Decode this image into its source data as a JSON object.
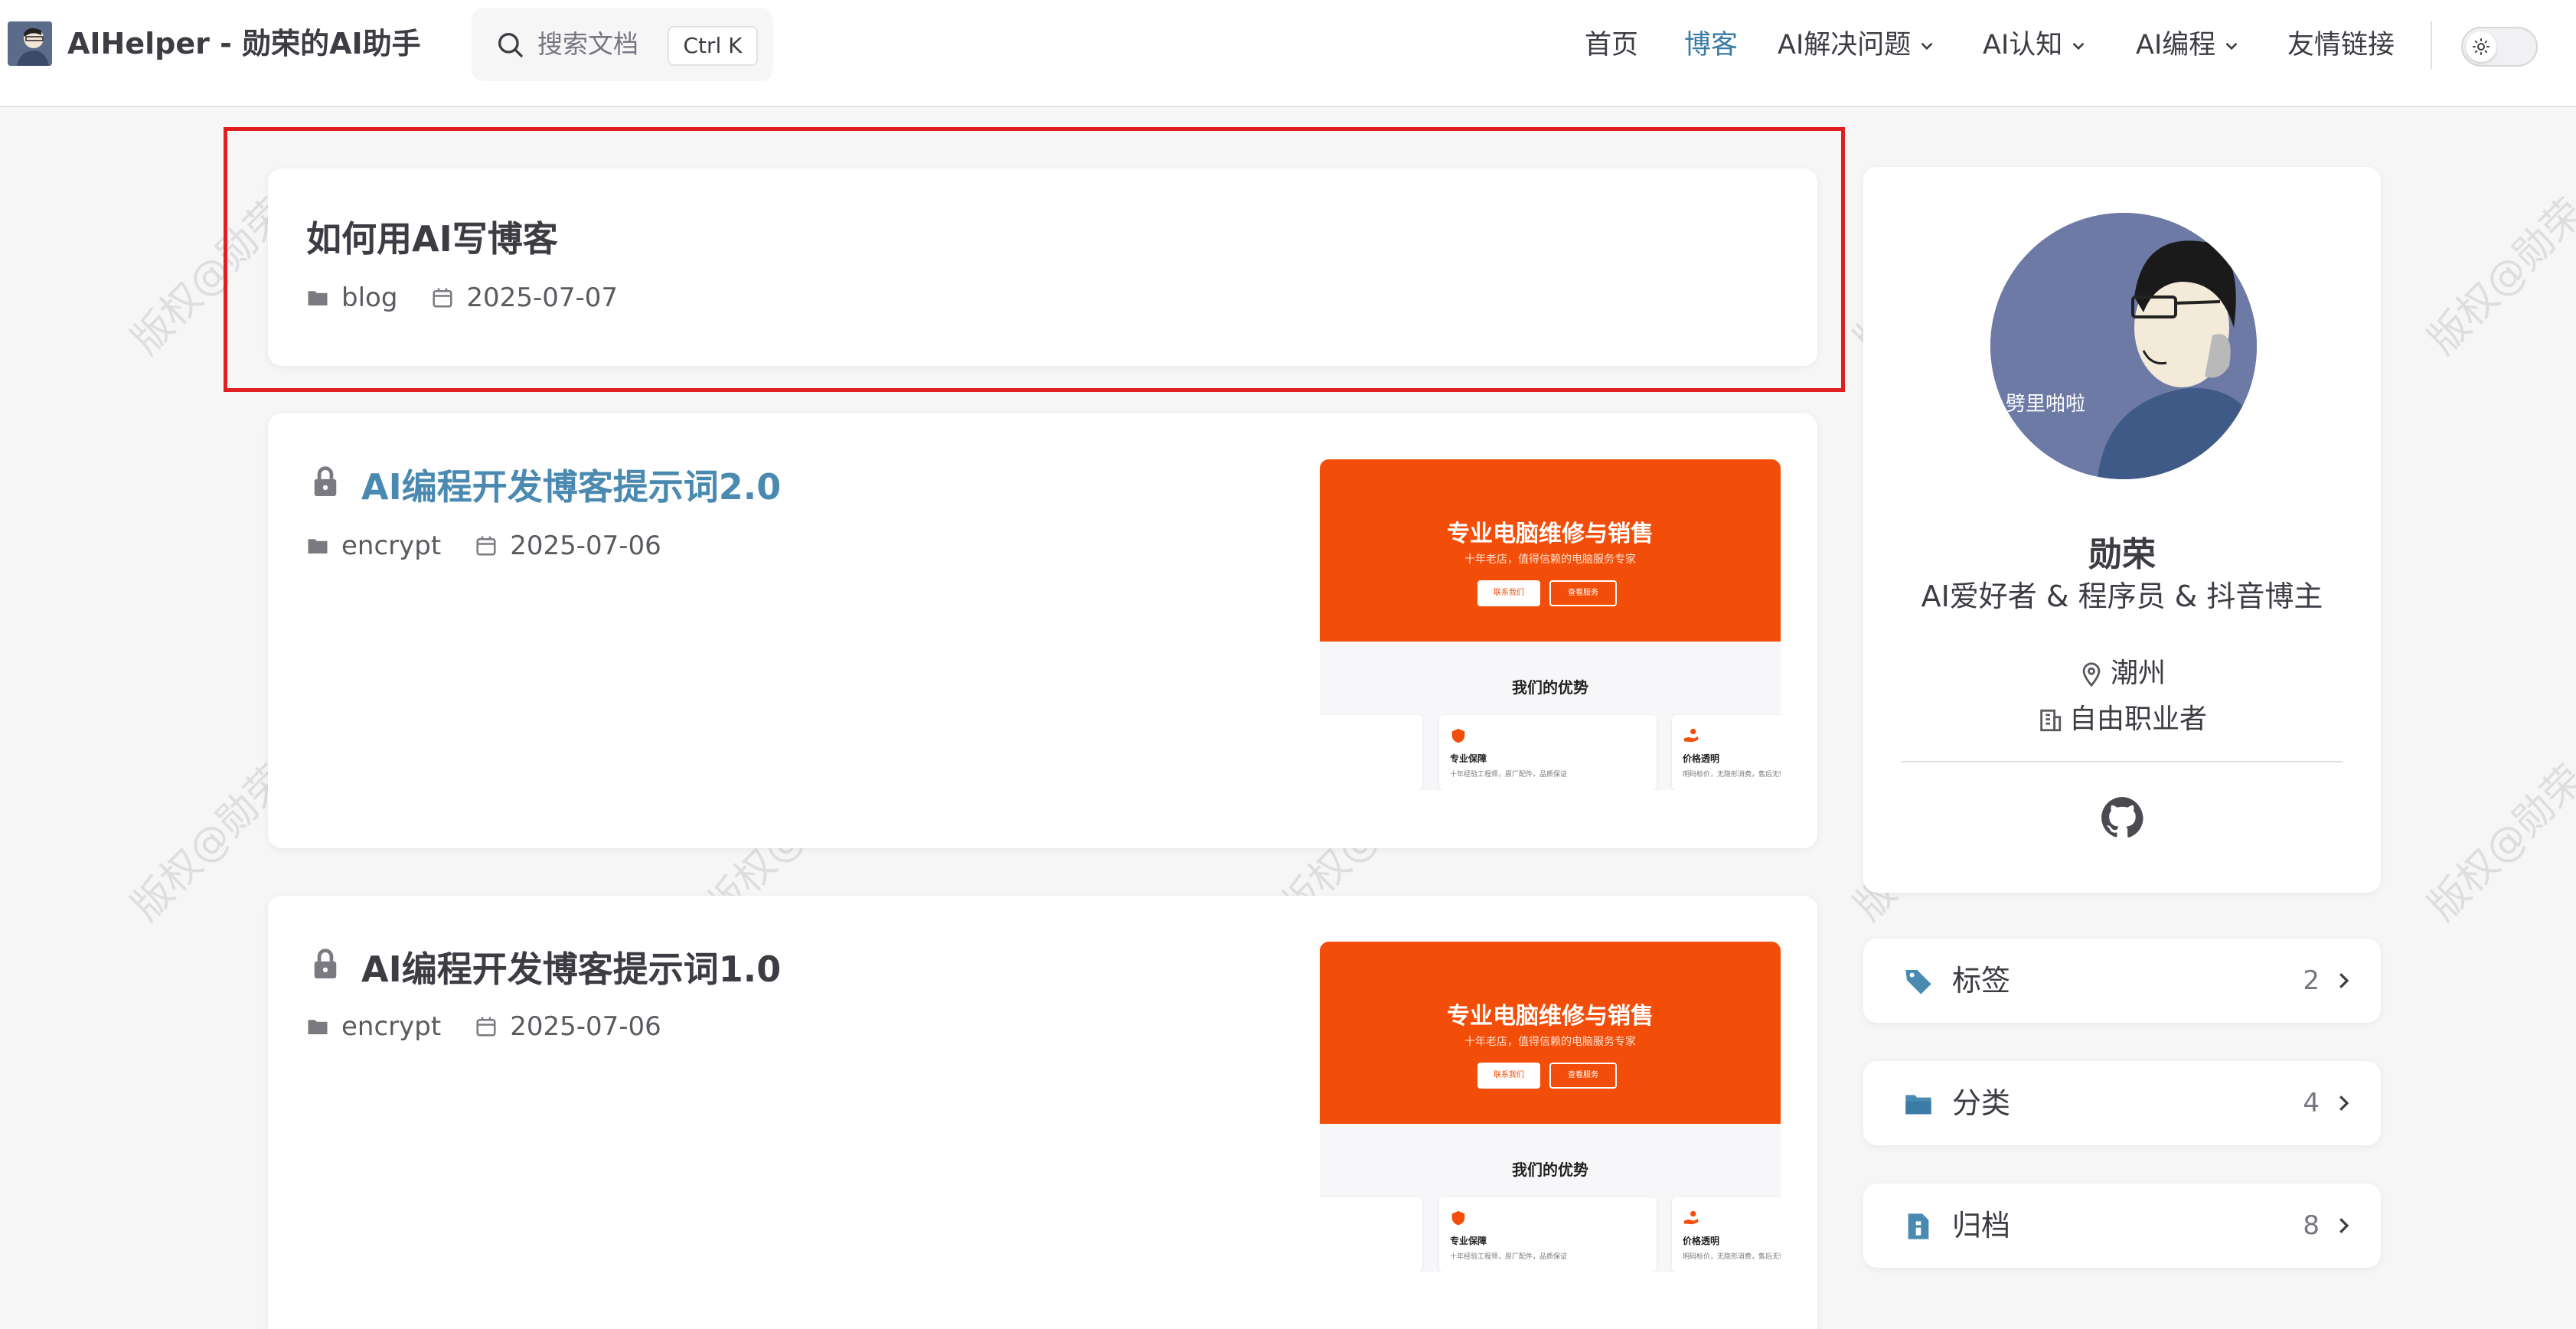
{
  "header": {
    "site_title": "AIHelper - 勋荣的AI助手",
    "search_placeholder": "搜索文档",
    "search_shortcut": "Ctrl K",
    "nav": [
      {
        "label": "首页",
        "active": false,
        "dropdown": false
      },
      {
        "label": "博客",
        "active": true,
        "dropdown": false
      },
      {
        "label": "AI解决问题",
        "active": false,
        "dropdown": true
      },
      {
        "label": "AI认知",
        "active": false,
        "dropdown": true
      },
      {
        "label": "AI编程",
        "active": false,
        "dropdown": true
      },
      {
        "label": "友情链接",
        "active": false,
        "dropdown": false
      }
    ]
  },
  "watermark_text": "版权@勋荣",
  "posts": [
    {
      "title": "如何用AI写博客",
      "category": "blog",
      "date": "2025-07-07",
      "locked": false,
      "highlighted": true
    },
    {
      "title": "AI编程开发博客提示词2.0",
      "category": "encrypt",
      "date": "2025-07-06",
      "locked": true,
      "highlighted": false,
      "thumbnail": {
        "hero_title": "专业电脑维修与销售",
        "hero_subtitle": "十年老店，值得信赖的电脑服务专家",
        "btn_primary": "联系我们",
        "btn_secondary": "查看服务",
        "section_title": "我们的优势",
        "features": [
          {
            "title": "专业保障",
            "desc": "十年经验工程师，原厂配件，品质保证"
          },
          {
            "title": "价格透明",
            "desc": "明码标价，无隐形消费，售后无忧"
          }
        ]
      }
    },
    {
      "title": "AI编程开发博客提示词1.0",
      "category": "encrypt",
      "date": "2025-07-06",
      "locked": true,
      "highlighted": false,
      "thumbnail": {
        "hero_title": "专业电脑维修与销售",
        "hero_subtitle": "十年老店，值得信赖的电脑服务专家",
        "btn_primary": "联系我们",
        "btn_secondary": "查看服务",
        "section_title": "我们的优势",
        "features": [
          {
            "title": "专业保障",
            "desc": "十年经验工程师，原厂配件，品质保证"
          },
          {
            "title": "价格透明",
            "desc": "明码标价，无隐形消费，售后无忧"
          }
        ]
      }
    }
  ],
  "profile": {
    "avatar_caption": "劈里啪啦",
    "name": "勋荣",
    "bio": "AI爱好者 & 程序员 & 抖音博主",
    "location": "潮州",
    "occupation": "自由职业者"
  },
  "sidebar": {
    "items": [
      {
        "label": "标签",
        "count": "2",
        "icon": "tag-icon"
      },
      {
        "label": "分类",
        "count": "4",
        "icon": "folder-icon"
      },
      {
        "label": "归档",
        "count": "8",
        "icon": "archive-icon"
      }
    ]
  },
  "colors": {
    "accent": "#3a7ba6",
    "link_title": "#4a8ab0",
    "highlight_border": "#e02020",
    "thumbnail_orange": "#f24e0a"
  }
}
